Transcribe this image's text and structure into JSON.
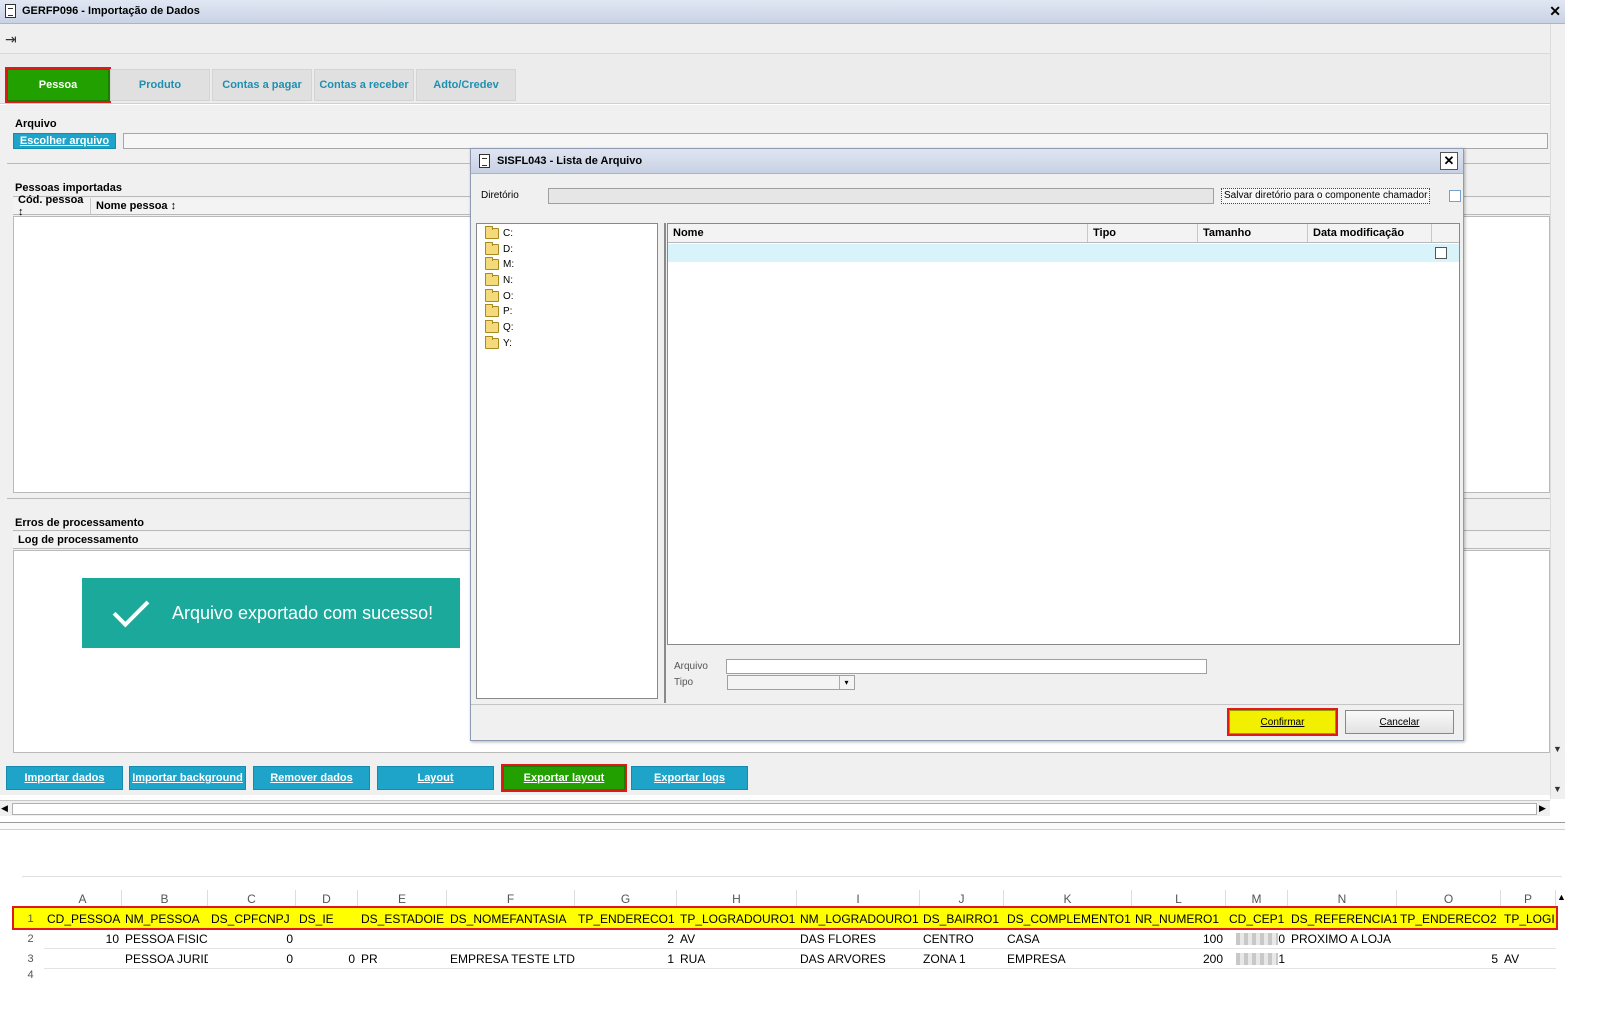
{
  "window": {
    "title": "GERFP096 - Importação de Dados",
    "close_glyph": "x"
  },
  "tabs": [
    {
      "label": "Pessoa",
      "active": true
    },
    {
      "label": "Produto",
      "active": false
    },
    {
      "label": "Contas a pagar",
      "active": false
    },
    {
      "label": "Contas a receber",
      "active": false
    },
    {
      "label": "Adto/Credev",
      "active": false
    }
  ],
  "file_section": {
    "label": "Arquivo",
    "choose_button": "Escolher arquivo"
  },
  "imported": {
    "label": "Pessoas importadas",
    "columns": [
      "Cód. pessoa ↕",
      "Nome pessoa ↕"
    ]
  },
  "errors": {
    "label": "Erros de processamento",
    "log_header": "Log de processamento"
  },
  "toast": {
    "message": "Arquivo exportado com sucesso!"
  },
  "actions": [
    {
      "label": "Importar dados",
      "highlight": false
    },
    {
      "label": "Importar background",
      "highlight": false
    },
    {
      "label": "Remover dados",
      "highlight": false
    },
    {
      "label": "Layout",
      "highlight": false
    },
    {
      "label": "Exportar layout",
      "highlight": true
    },
    {
      "label": "Exportar logs",
      "highlight": false
    }
  ],
  "dialog": {
    "title": "SISFL043 - Lista de Arquivo",
    "directory_label": "Diretório",
    "save_dir_label": "Salvar diretório para o componente chamador",
    "drives": [
      "C:",
      "D:",
      "M:",
      "N:",
      "O:",
      "P:",
      "Q:",
      "Y:"
    ],
    "file_columns": [
      "Nome",
      "Tipo",
      "Tamanho",
      "Data modificação"
    ],
    "file_label": "Arquivo",
    "type_label": "Tipo",
    "confirm": "Confirmar",
    "cancel": "Cancelar"
  },
  "spreadsheet": {
    "columns": [
      "A",
      "B",
      "C",
      "D",
      "E",
      "F",
      "G",
      "H",
      "I",
      "J",
      "K",
      "L",
      "M",
      "N",
      "O",
      "P"
    ],
    "row_numbers": [
      "1",
      "2",
      "3",
      "4"
    ],
    "header_row": [
      "CD_PESSOA",
      "NM_PESSOA",
      "DS_CPFCNPJ",
      "DS_IE",
      "DS_ESTADOIE",
      "DS_NOMEFANTASIA",
      "TP_ENDERECO1",
      "TP_LOGRADOURO1",
      "NM_LOGRADOURO1",
      "DS_BAIRRO1",
      "DS_COMPLEMENTO1",
      "NR_NUMERO1",
      "CD_CEP1",
      "DS_REFERENCIA1",
      "TP_ENDERECO2",
      "TP_LOGI"
    ],
    "rows": [
      [
        "10",
        "PESSOA FISICA",
        "0",
        "",
        "",
        "",
        "2",
        "AV",
        "DAS FLORES",
        "CENTRO",
        "CASA",
        "100",
        "0",
        "PROXIMO A LOJA",
        "",
        ""
      ],
      [
        "",
        "PESSOA JURIDICA",
        "0",
        "0",
        "PR",
        "EMPRESA TESTE LTDA",
        "1",
        "RUA",
        "DAS ARVORES",
        "ZONA 1",
        "EMPRESA",
        "200",
        "1",
        "",
        "5",
        "AV"
      ]
    ]
  },
  "colors": {
    "accent_blue": "#1ea3c9",
    "active_green": "#22a000",
    "highlight_red": "#e01a1a",
    "toast_teal": "#1aa99a",
    "excel_yellow": "#ffff00"
  }
}
